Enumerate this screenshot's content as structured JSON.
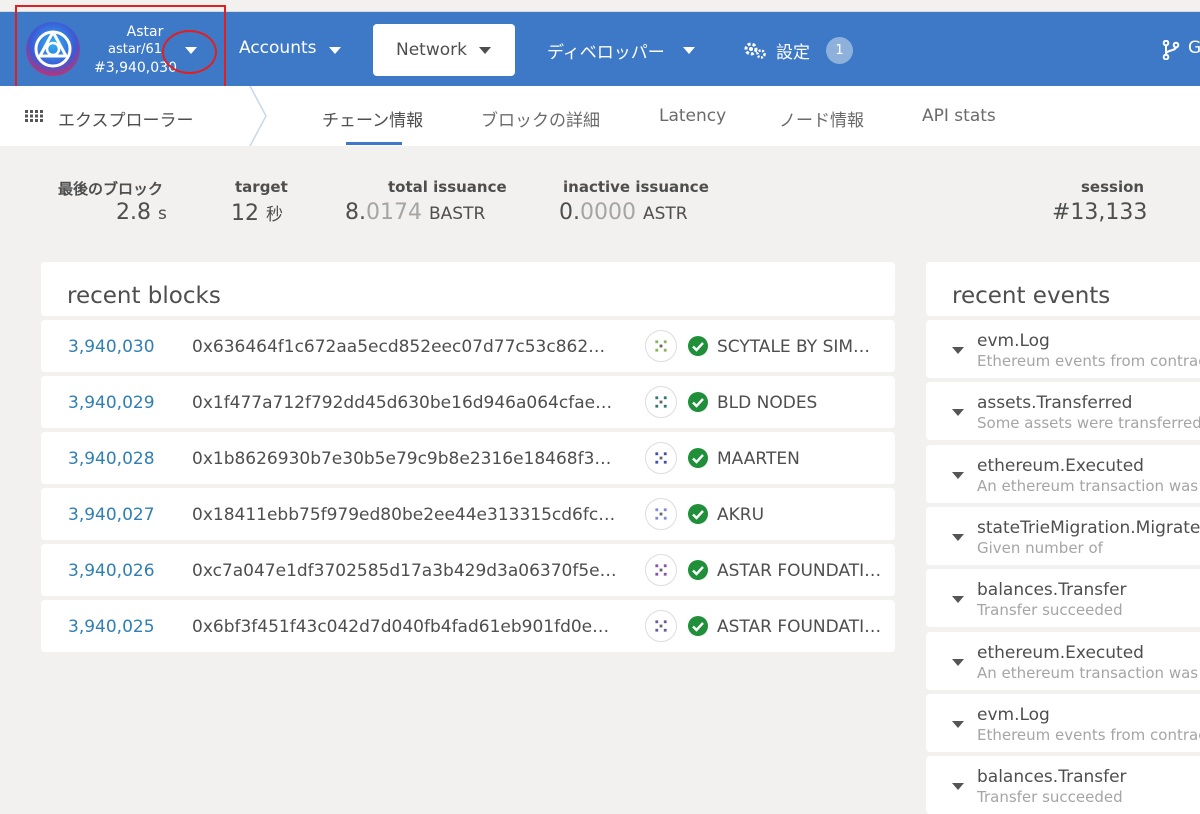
{
  "header": {
    "chain_name": "Astar",
    "runtime": "astar/61",
    "block": "#3,940,030",
    "nav": [
      {
        "label": "Accounts"
      },
      {
        "label": "Network"
      },
      {
        "label": "ディベロッパー"
      },
      {
        "label": "設定"
      }
    ],
    "settings_badge": "1",
    "github_label": "G"
  },
  "subnav": {
    "section": "エクスプローラー",
    "tabs": [
      "チェーン情報",
      "ブロックの詳細",
      "Latency",
      "ノード情報",
      "API stats"
    ],
    "active_tab": "チェーン情報"
  },
  "summary": {
    "last_block": {
      "label": "最後のブロック",
      "value": "2.8",
      "unit": "s"
    },
    "target": {
      "label": "target",
      "value": "12",
      "unit": "秒"
    },
    "total_issuance": {
      "label": "total issuance",
      "int": "8.",
      "frac": "0174",
      "unit": "BASTR"
    },
    "inactive_issuance": {
      "label": "inactive issuance",
      "int": "0.",
      "frac": "0000",
      "unit": "ASTR"
    },
    "session": {
      "label": "session",
      "value": "#13,133"
    }
  },
  "recent_blocks": {
    "title": "recent blocks",
    "rows": [
      {
        "number": "3,940,030",
        "hash": "0x636464f1c672aa5ecd852eec07d77c53c862…",
        "author": "SCYTALE BY SIM…"
      },
      {
        "number": "3,940,029",
        "hash": "0x1f477a712f792dd45d630be16d946a064cfae…",
        "author": "BLD NODES"
      },
      {
        "number": "3,940,028",
        "hash": "0x1b8626930b7e30b5e79c9b8e2316e18468f3…",
        "author": "MAARTEN"
      },
      {
        "number": "3,940,027",
        "hash": "0x18411ebb75f979ed80be2ee44e313315cd6fc…",
        "author": "AKRU"
      },
      {
        "number": "3,940,026",
        "hash": "0xc7a047e1df3702585d17a3b429d3a06370f5e…",
        "author": "ASTAR FOUNDATI…"
      },
      {
        "number": "3,940,025",
        "hash": "0x6bf3f451f43c042d7d040fb4fad61eb901fd0e…",
        "author": "ASTAR FOUNDATI…"
      }
    ]
  },
  "recent_events": {
    "title": "recent events",
    "rows": [
      {
        "name": "evm.Log",
        "desc": "Ethereum events from contrac"
      },
      {
        "name": "assets.Transferred",
        "desc": "Some assets were transferred"
      },
      {
        "name": "ethereum.Executed",
        "desc": "An ethereum transaction was"
      },
      {
        "name": "stateTrieMigration.Migrated",
        "desc": "Given number of"
      },
      {
        "name": "balances.Transfer",
        "desc": "Transfer succeeded"
      },
      {
        "name": "ethereum.Executed",
        "desc": "An ethereum transaction was"
      },
      {
        "name": "evm.Log",
        "desc": "Ethereum events from contrac"
      },
      {
        "name": "balances.Transfer",
        "desc": "Transfer succeeded"
      }
    ]
  },
  "colors": {
    "header_bg": "#3e79c7",
    "link": "#2f7fb4",
    "check": "#1f8f3a",
    "annotation": "#e02020"
  }
}
